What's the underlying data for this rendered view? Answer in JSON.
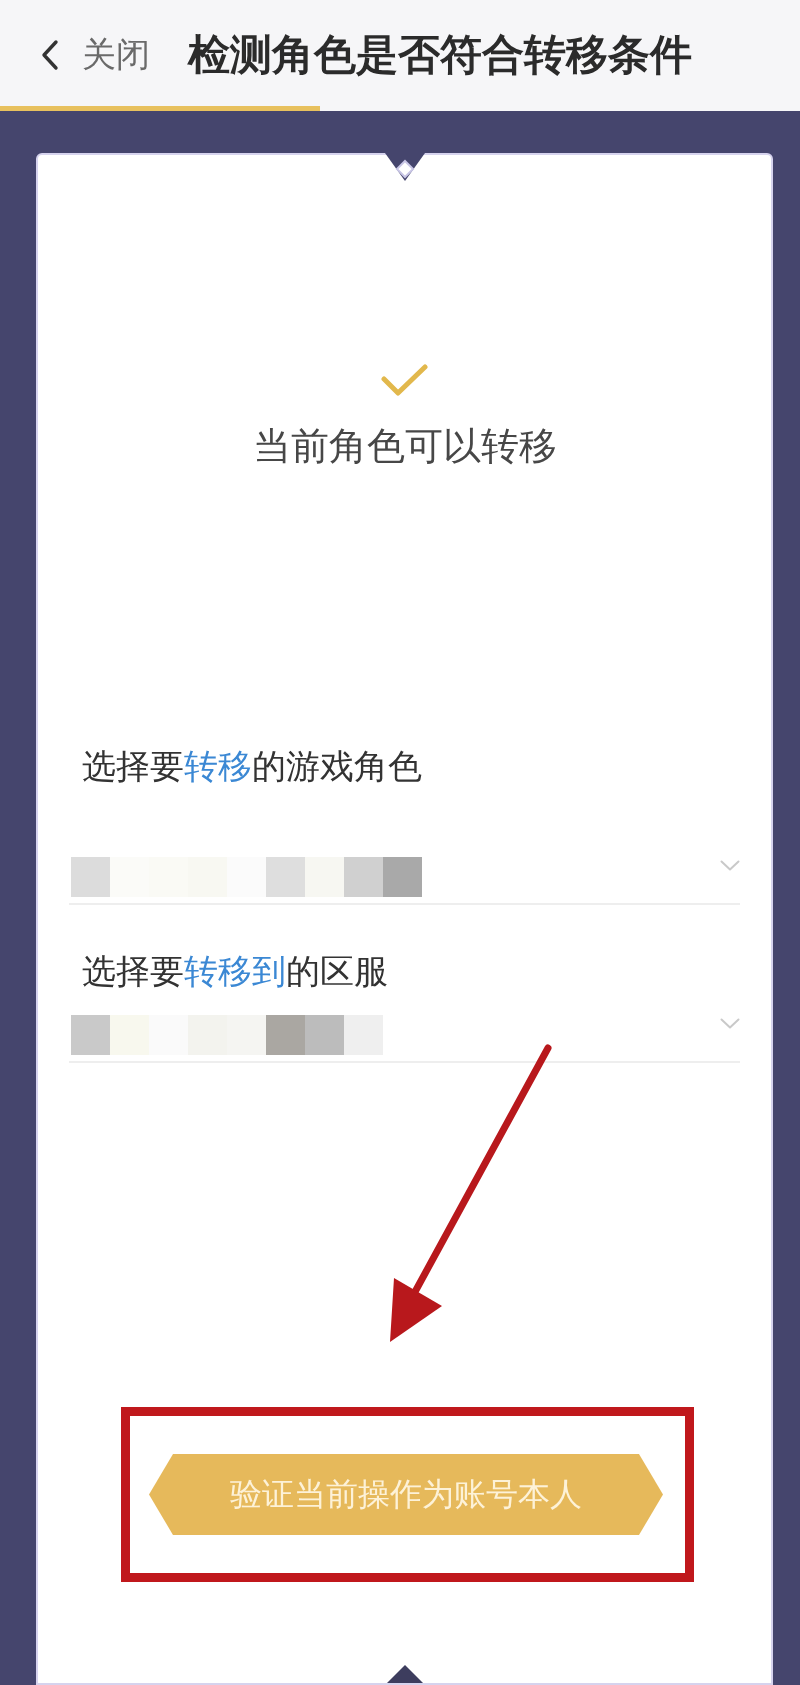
{
  "header": {
    "back_label": "关闭",
    "title": "检测角色是否符合转移条件",
    "load_progress": {
      "level": 0.4
    }
  },
  "status": {
    "kind": "success",
    "message": "当前角色可以转移"
  },
  "fields": [
    {
      "label": [
        {
          "text": "选择要",
          "highlight": false
        },
        {
          "text": "转移",
          "highlight": true
        },
        {
          "text": "的游戏角色",
          "highlight": false
        }
      ],
      "value_hidden": true
    },
    {
      "label": [
        {
          "text": "选择要",
          "highlight": false
        },
        {
          "text": "转移到",
          "highlight": true
        },
        {
          "text": "的区服",
          "highlight": false
        }
      ],
      "value_hidden": true
    }
  ],
  "verify_button": {
    "label": "验证当前操作为账号本人",
    "highlighted": true
  },
  "annotation_arrow": true
}
